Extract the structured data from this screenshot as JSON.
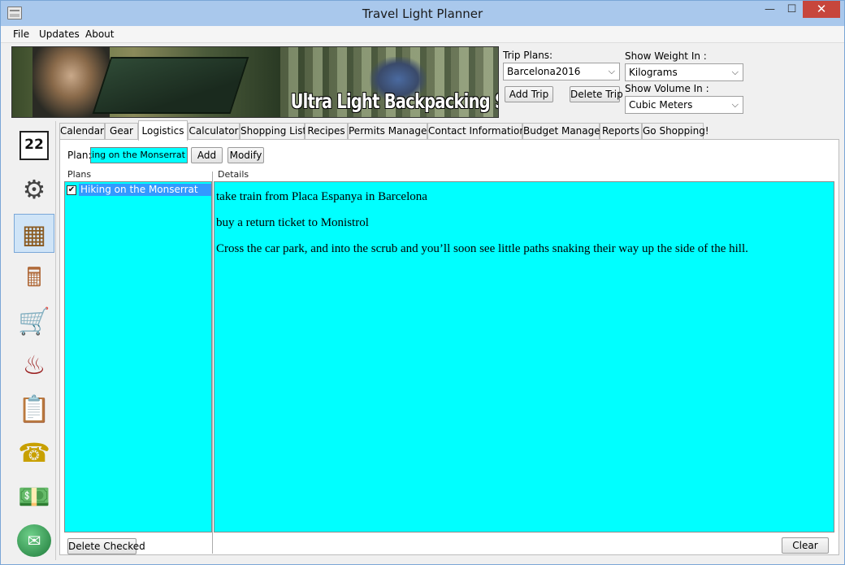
{
  "window": {
    "title": "Travel Light Planner",
    "min_glyph": "—",
    "max_glyph": "☐",
    "close_glyph": "✕"
  },
  "menu": [
    "File",
    "Updates",
    "About"
  ],
  "banner": {
    "text": "Ultra Light Backpacking Software"
  },
  "trip": {
    "label": "Trip Plans:",
    "value": "Barcelona2016",
    "add_label": "Add Trip",
    "delete_label": "Delete Trip"
  },
  "weight": {
    "label": "Show Weight In :",
    "value": "Kilograms"
  },
  "volume": {
    "label": "Show Volume In :",
    "value": "Cubic Meters"
  },
  "tabs": [
    "Calendar",
    "Gear",
    "Logistics",
    "Calculator",
    "Shopping List",
    "Recipes",
    "Permits Manager",
    "Contact Information",
    "Budget Manager",
    "Reports",
    "Go Shopping!"
  ],
  "active_tab": "Logistics",
  "plan": {
    "label": "Plan:",
    "value": "Hiking on the Monserrat",
    "add_label": "Add",
    "modify_label": "Modify"
  },
  "plans": {
    "header": "Plans",
    "items": [
      {
        "label": "Hiking on the Monserrat",
        "checked": true
      }
    ],
    "delete_label": "Delete Checked"
  },
  "details": {
    "header": "Details",
    "lines": [
      "take train from Placa Espanya in Barcelona",
      "buy a return ticket to Monistrol",
      "Cross the car park, and into the scrub and you’ll soon see little paths snaking their way up the side of the hill."
    ],
    "clear_label": "Clear"
  },
  "toolbar": {
    "calendar_day": "22",
    "icons": [
      "calendar-icon",
      "gear-icon",
      "map-icon",
      "calculator-icon",
      "shopping-cart-icon",
      "chef-hat-icon",
      "clipboard-icon",
      "phone-icon",
      "money-icon",
      "email-icon"
    ]
  },
  "colors": {
    "field_bg": "#00ffff",
    "selection": "#3399ff",
    "titlebar": "#a9c8ec",
    "close": "#c7463c"
  }
}
